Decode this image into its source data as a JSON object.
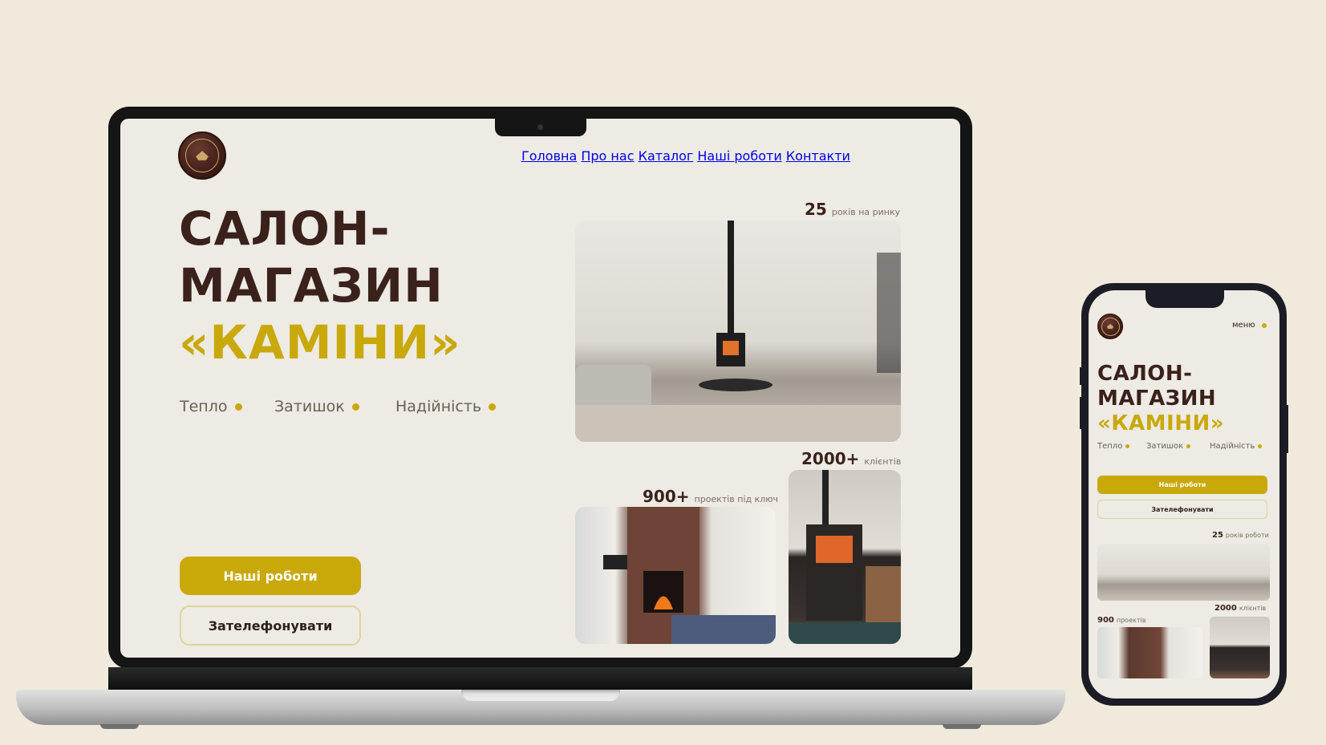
{
  "desktop": {
    "nav": [
      "Головна",
      "Про нас",
      "Каталог",
      "Наші роботи",
      "Контакти"
    ],
    "hero": {
      "line1": "САЛОН-",
      "line2": "МАГАЗИН",
      "line3": "«КАМІНИ»",
      "tags": [
        "Тепло",
        "Затишок",
        "Надійність"
      ]
    },
    "buttons": {
      "primary": "Наші роботи",
      "secondary": "Зателефонувати"
    },
    "stats": {
      "years_value": "25",
      "years_label": "років на ринку",
      "clients_value": "2000+",
      "clients_label": "клієнтів",
      "projects_value": "900+",
      "projects_label": "проектів під ключ"
    }
  },
  "mobile": {
    "menu": "меню",
    "hero": {
      "line1": "САЛОН-",
      "line2": "МАГАЗИН",
      "line3": "«КАМІНИ»",
      "tags": [
        "Тепло",
        "Затишок",
        "Надійність"
      ]
    },
    "buttons": {
      "primary": "Наші роботи",
      "secondary": "Зателефонувати"
    },
    "stats": {
      "years_value": "25",
      "years_label": "років роботи",
      "clients_value": "2000",
      "clients_label": "клієнтів",
      "projects_value": "900",
      "projects_label": "проектів"
    }
  },
  "colors": {
    "background": "#efeadb",
    "screen": "#edebe3",
    "accent": "#c9a80a",
    "heading": "#3a211c"
  }
}
